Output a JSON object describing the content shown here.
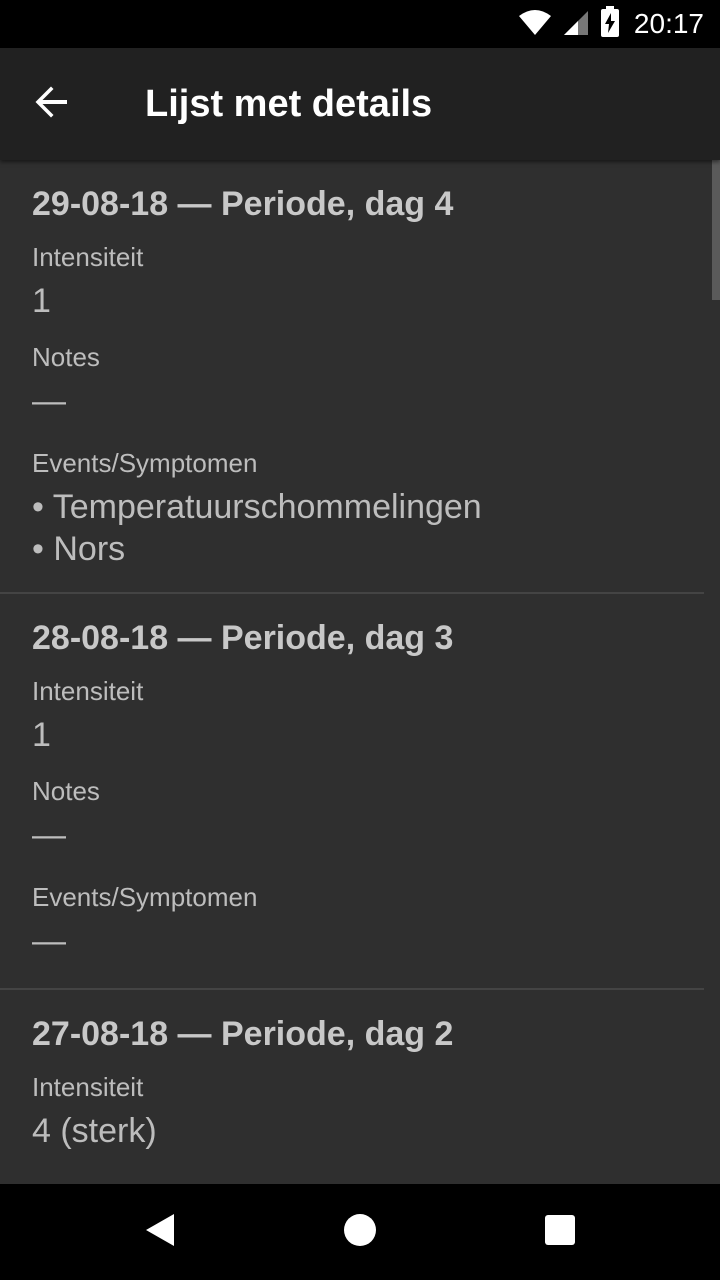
{
  "status_bar": {
    "time": "20:17",
    "icons": [
      "wifi-icon",
      "cell-signal-icon",
      "battery-charging-icon"
    ]
  },
  "app_bar": {
    "back_icon": "arrow-back-icon",
    "title": "Lijst met details"
  },
  "entries": [
    {
      "title": "29-08-18 — Periode, dag 4",
      "intensity_label": "Intensiteit",
      "intensity_value": "1",
      "notes_label": "Notes",
      "notes_value": "—",
      "events_label": "Events/Symptomen",
      "events": [
        "• Temperatuurschommelingen",
        "• Nors"
      ]
    },
    {
      "title": "28-08-18 — Periode, dag 3",
      "intensity_label": "Intensiteit",
      "intensity_value": "1",
      "notes_label": "Notes",
      "notes_value": "—",
      "events_label": "Events/Symptomen",
      "events": [
        "—"
      ]
    },
    {
      "title": "27-08-18 — Periode, dag 2",
      "intensity_label": "Intensiteit",
      "intensity_value": "4 (sterk)"
    }
  ],
  "nav_bar": {
    "icons": [
      "back-triangle-icon",
      "home-circle-icon",
      "recents-square-icon"
    ]
  }
}
